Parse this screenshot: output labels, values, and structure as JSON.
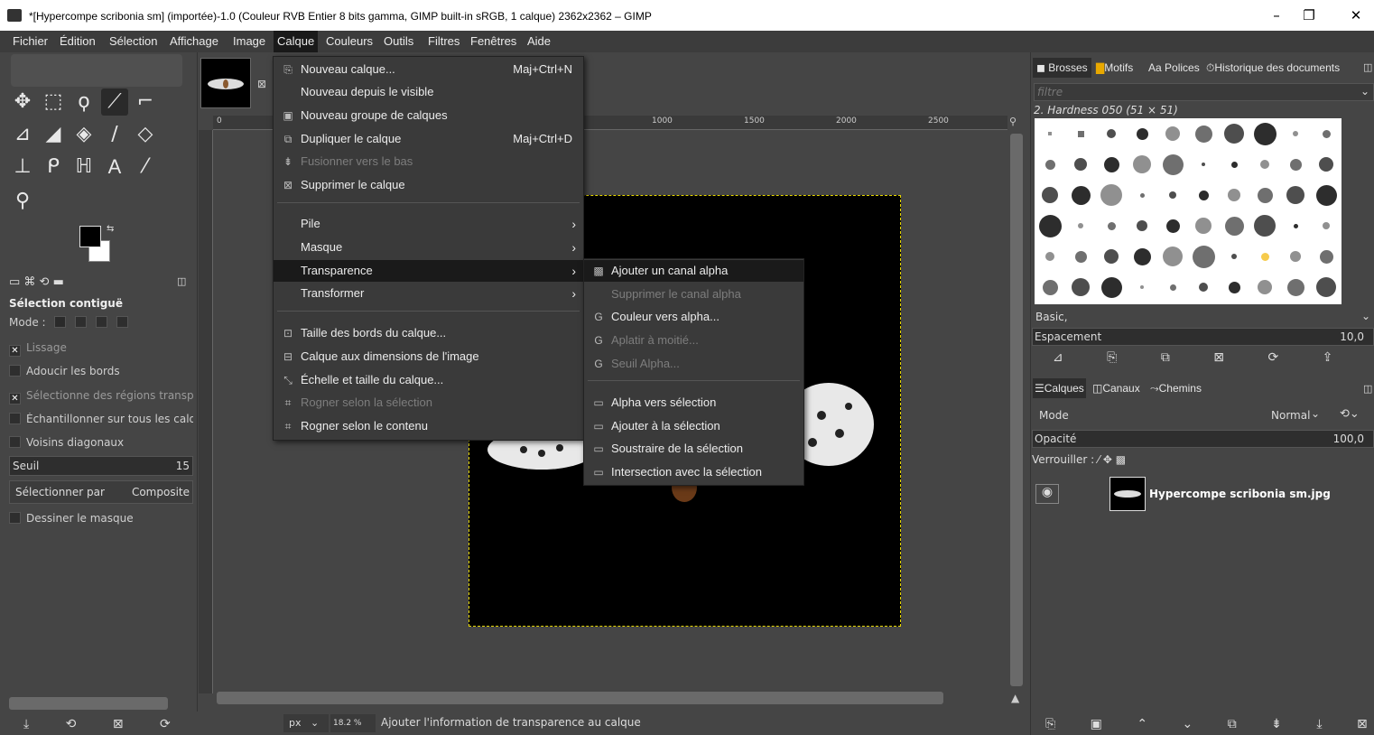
{
  "window": {
    "title": "*[Hypercompe scribonia sm] (importée)-1.0 (Couleur RVB Entier 8 bits gamma, GIMP built-in sRGB, 1 calque) 2362x2362 – GIMP",
    "minimize": "–",
    "maximize": "❐",
    "close": "✕"
  },
  "menubar": [
    "Fichier",
    "Édition",
    "Sélection",
    "Affichage",
    "Image",
    "Calque",
    "Couleurs",
    "Outils",
    "Filtres",
    "Fenêtres",
    "Aide"
  ],
  "calque_menu": {
    "items": [
      {
        "label": "Nouveau calque...",
        "shortcut": "Maj+Ctrl+N",
        "icon": "new-layer-icon",
        "enabled": true
      },
      {
        "label": "Nouveau depuis le visible",
        "shortcut": "",
        "icon": "",
        "enabled": true
      },
      {
        "label": "Nouveau groupe de calques",
        "shortcut": "",
        "icon": "layer-group-icon",
        "enabled": true
      },
      {
        "label": "Dupliquer le calque",
        "shortcut": "Maj+Ctrl+D",
        "icon": "duplicate-icon",
        "enabled": true
      },
      {
        "label": "Fusionner vers le bas",
        "shortcut": "",
        "icon": "merge-down-icon",
        "enabled": false
      },
      {
        "label": "Supprimer le calque",
        "shortcut": "",
        "icon": "delete-icon",
        "enabled": true
      },
      {
        "label": "Pile",
        "submenu": true
      },
      {
        "label": "Masque",
        "submenu": true
      },
      {
        "label": "Transparence",
        "submenu": true,
        "highlighted": true
      },
      {
        "label": "Transformer",
        "submenu": true
      },
      {
        "label": "Taille des bords du calque...",
        "icon": "layer-boundary-icon",
        "enabled": true
      },
      {
        "label": "Calque aux dimensions de l'image",
        "icon": "layer-to-image-icon",
        "enabled": true
      },
      {
        "label": "Échelle et taille du calque...",
        "icon": "scale-layer-icon",
        "enabled": true
      },
      {
        "label": "Rogner selon la sélection",
        "icon": "crop-icon",
        "enabled": false
      },
      {
        "label": "Rogner selon le contenu",
        "icon": "crop-content-icon",
        "enabled": true
      }
    ]
  },
  "transparence_submenu": [
    {
      "label": "Ajouter un canal alpha",
      "enabled": true,
      "highlighted": true
    },
    {
      "label": "Supprimer le canal alpha",
      "enabled": false
    },
    {
      "label": "Couleur vers alpha...",
      "enabled": true
    },
    {
      "label": "Aplatir à moitié...",
      "enabled": false
    },
    {
      "label": "Seuil Alpha...",
      "enabled": false
    },
    {
      "label": "Alpha vers sélection",
      "enabled": true
    },
    {
      "label": "Ajouter à la sélection",
      "enabled": true
    },
    {
      "label": "Soustraire de la sélection",
      "enabled": true
    },
    {
      "label": "Intersection avec la sélection",
      "enabled": true
    }
  ],
  "tool_options": {
    "title": "Sélection contiguë",
    "mode_label": "Mode :",
    "antialias": "Lissage",
    "feather": "Adoucir les bords",
    "select_transparent": "Sélectionne des régions transparentes",
    "sample_merged": "Échantillonner sur tous les calques",
    "diagonal": "Voisins diagonaux",
    "threshold_label": "Seuil",
    "threshold_value": "15",
    "select_by_label": "Sélectionner par",
    "select_by_value": "Composite",
    "draw_mask": "Dessiner le masque"
  },
  "ruler": {
    "ticks": [
      "0",
      "1000",
      "1500",
      "2000",
      "2500"
    ]
  },
  "statusbar": {
    "unit": "px",
    "zoom": "18.2 %",
    "message": "Ajouter l'information de transparence au calque"
  },
  "right_panel": {
    "tabs_top": [
      "Brosses",
      "Motifs",
      "Polices",
      "Historique des documents"
    ],
    "filter_placeholder": "filtre",
    "brush_name": "2. Hardness 050 (51 × 51)",
    "preset": "Basic,",
    "spacing_label": "Espacement",
    "spacing_value": "10,0",
    "tabs_layers": [
      "Calques",
      "Canaux",
      "Chemins"
    ],
    "mode_label": "Mode",
    "mode_value": "Normal",
    "opacity_label": "Opacité",
    "opacity_value": "100,0",
    "lock_label": "Verrouiller :",
    "layer_name": "Hypercompe scribonia sm.jpg"
  },
  "colors": {
    "accent": "#1a1a1a",
    "selection": "#e8d800"
  }
}
